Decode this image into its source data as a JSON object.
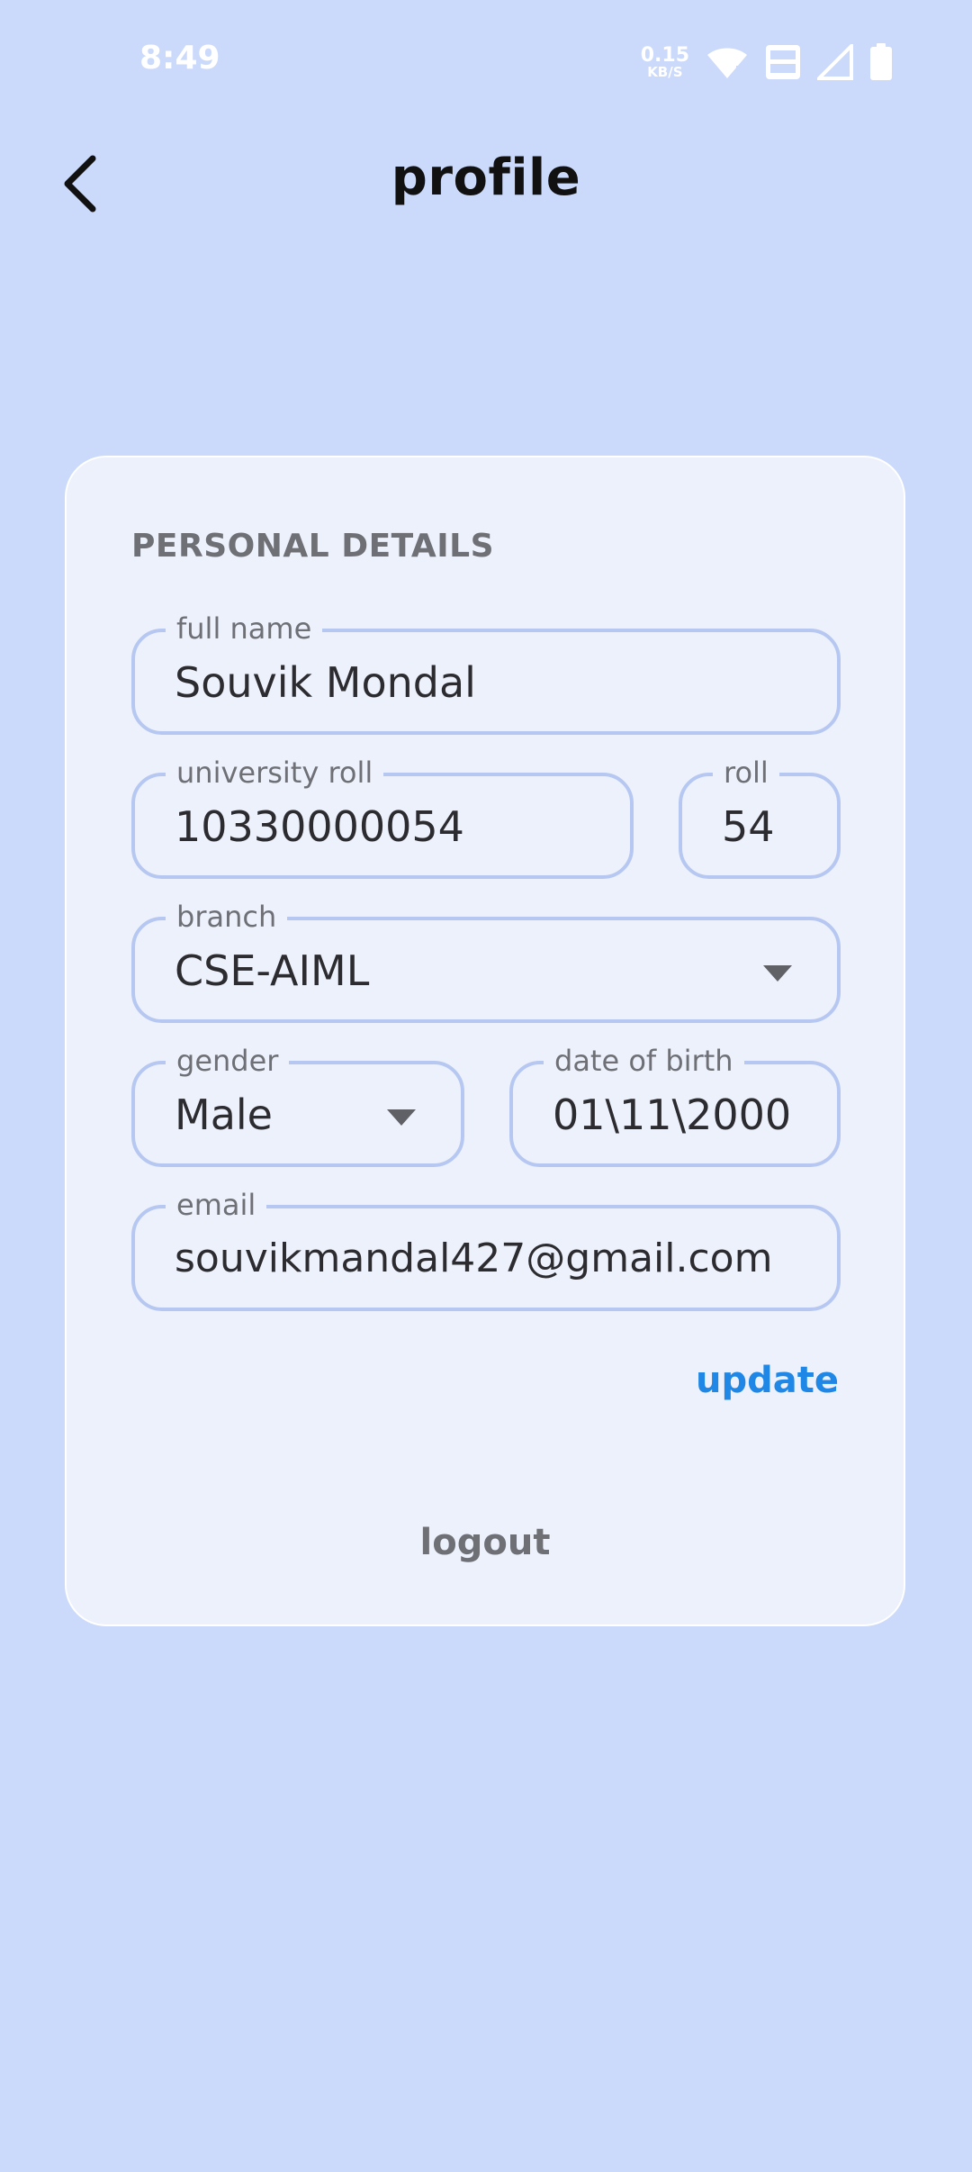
{
  "status_bar": {
    "time": "8:49",
    "net_speed_value": "0.15",
    "net_speed_unit": "KB/S",
    "icons": [
      "wifi-icon",
      "volte-icon",
      "signal-icon",
      "battery-icon"
    ]
  },
  "header": {
    "title": "profile",
    "back_icon": "chevron-left-icon"
  },
  "card": {
    "section_title": "PERSONAL DETAILS",
    "fields": {
      "full_name": {
        "label": "full name",
        "value": "Souvik Mondal"
      },
      "university_roll": {
        "label": "university roll",
        "value": "10330000054"
      },
      "roll": {
        "label": "roll",
        "value": "54"
      },
      "branch": {
        "label": "branch",
        "value": "CSE-AIML"
      },
      "gender": {
        "label": "gender",
        "value": "Male"
      },
      "dob": {
        "label": "date of birth",
        "value": "01\\11\\2000"
      },
      "email": {
        "label": "email",
        "value": "souvikmandal427@gmail.com"
      }
    },
    "update_label": "update",
    "logout_label": "logout"
  },
  "colors": {
    "background": "#cbd9fb",
    "card": "#edf1fc",
    "field_border": "#b6c8f1",
    "accent": "#1f87e6",
    "muted_text": "#6e7076"
  }
}
